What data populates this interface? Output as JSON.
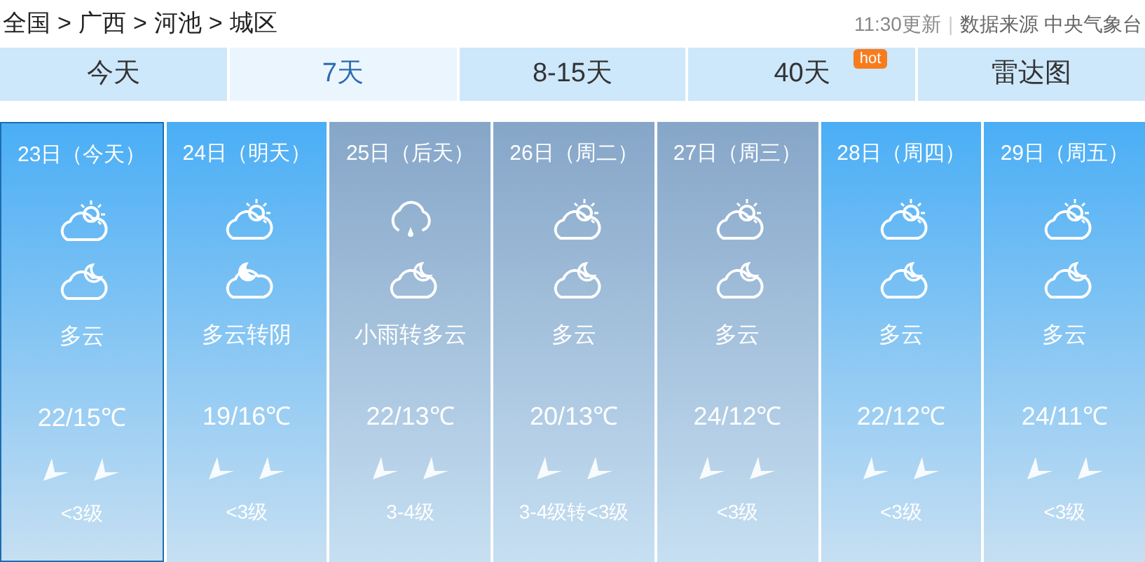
{
  "breadcrumb": [
    {
      "label": "全国"
    },
    {
      "label": ">"
    },
    {
      "label": "广西"
    },
    {
      "label": ">"
    },
    {
      "label": "河池"
    },
    {
      "label": ">"
    },
    {
      "label": "城区"
    }
  ],
  "update_time": "11:30更新",
  "separator": "|",
  "source": "数据来源 中央气象台",
  "tabs": [
    {
      "label": "今天",
      "selected": false
    },
    {
      "label": "7天",
      "selected": true
    },
    {
      "label": "8-15天",
      "selected": false
    },
    {
      "label": "40天",
      "selected": false,
      "badge": "hot"
    },
    {
      "label": "雷达图",
      "selected": false
    }
  ],
  "days": [
    {
      "date": "23日（今天）",
      "selected": true,
      "color": "#4aaef5",
      "day_icon": {
        "kind": "partly-cloudy"
      },
      "night_icon": {
        "kind": "cloudy-night"
      },
      "weather": "多云",
      "temp": "22/15℃",
      "wind": "<3级"
    },
    {
      "date": "24日（明天）",
      "selected": false,
      "color": "#4aaef5",
      "day_icon": {
        "kind": "partly-cloudy"
      },
      "night_icon": {
        "kind": "moon-cloud"
      },
      "weather": "多云转阴",
      "temp": "19/16℃",
      "wind": "<3级"
    },
    {
      "date": "25日（后天）",
      "selected": false,
      "color": "#86a6c8",
      "day_icon": {
        "kind": "rain"
      },
      "night_icon": {
        "kind": "cloudy-night"
      },
      "weather": "小雨转多云",
      "temp": "22/13℃",
      "wind": "3-4级"
    },
    {
      "date": "26日（周二）",
      "selected": false,
      "color": "#86a6c8",
      "day_icon": {
        "kind": "partly-cloudy"
      },
      "night_icon": {
        "kind": "cloudy-night"
      },
      "weather": "多云",
      "temp": "20/13℃",
      "wind": "3-4级转<3级"
    },
    {
      "date": "27日（周三）",
      "selected": false,
      "color": "#86a6c8",
      "day_icon": {
        "kind": "partly-cloudy"
      },
      "night_icon": {
        "kind": "cloudy-night"
      },
      "weather": "多云",
      "temp": "24/12℃",
      "wind": "<3级"
    },
    {
      "date": "28日（周四）",
      "selected": false,
      "color": "#4aaef5",
      "day_icon": {
        "kind": "partly-cloudy"
      },
      "night_icon": {
        "kind": "cloudy-night"
      },
      "weather": "多云",
      "temp": "22/12℃",
      "wind": "<3级"
    },
    {
      "date": "29日（周五）",
      "selected": false,
      "color": "#4aaef5",
      "day_icon": {
        "kind": "partly-cloudy"
      },
      "night_icon": {
        "kind": "cloudy-night"
      },
      "weather": "多云",
      "temp": "24/11℃",
      "wind": "<3级"
    }
  ]
}
